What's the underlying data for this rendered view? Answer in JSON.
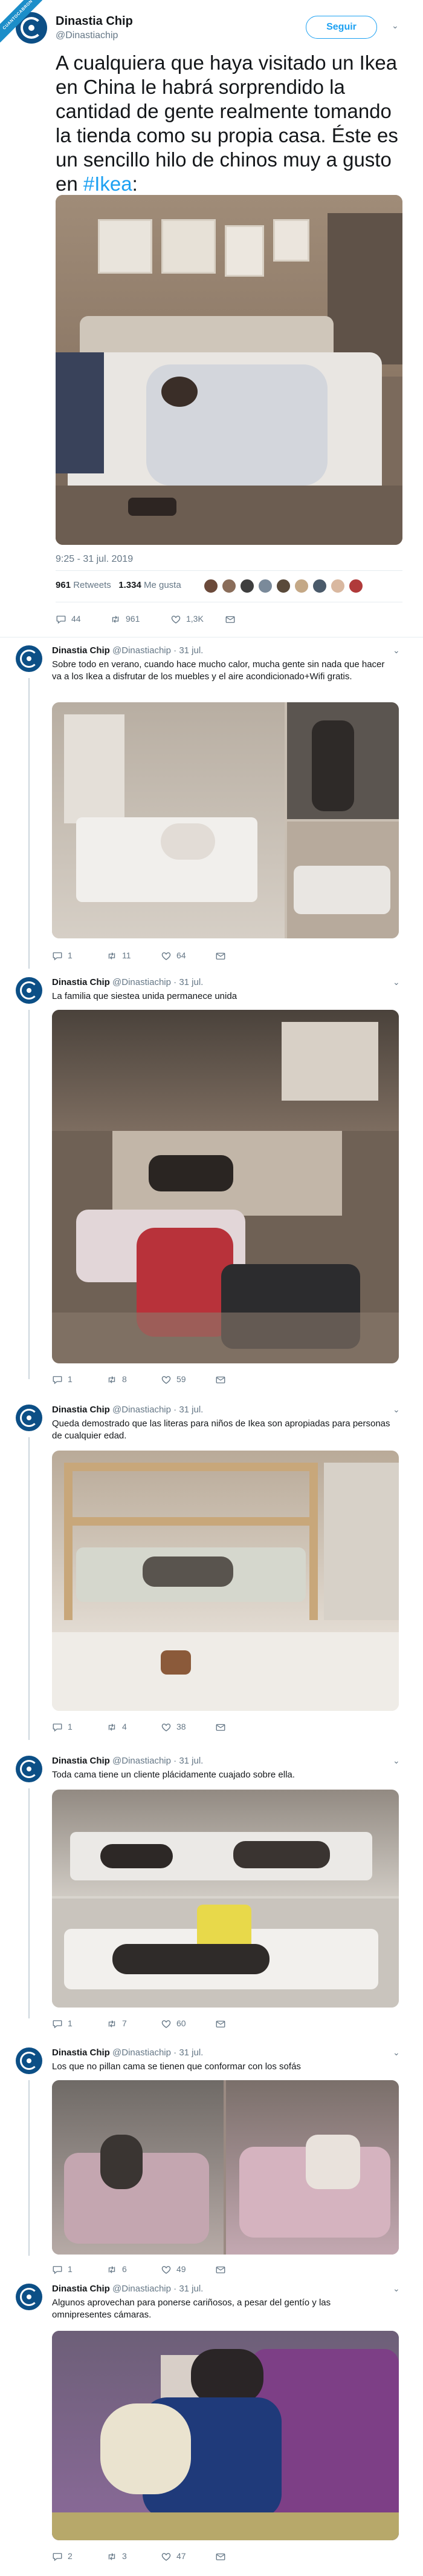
{
  "badge": "CUANTOCABRON",
  "tweet": {
    "author_name": "Dinastia Chip",
    "author_handle": "@Dinastiachip",
    "follow_label": "Seguir",
    "text": "A cualquiera que haya visitado un Ikea en China le habrá sorprendido la cantidad de gente realmente tomando la tienda como su propia casa. Éste es un sencillo hilo de chinos muy a gusto en ",
    "hashtag": "#Ikea",
    "text_end": ":",
    "timestamp": "9:25 - 31 jul. 2019",
    "retweets_count": "961",
    "retweets_label": "Retweets",
    "likes_count": "1.334",
    "likes_label": "Me gusta",
    "reply_count": "44",
    "retweet_count": "961",
    "like_count": "1,3K"
  },
  "replies": [
    {
      "name": "Dinastia Chip",
      "handle": "@Dinastiachip",
      "date": "31 jul.",
      "text": "Sobre todo en verano, cuando hace mucho calor, mucha gente sin nada que hacer va a los Ikea a disfrutar de los muebles y el aire acondicionado+Wifi gratis.",
      "reply": "1",
      "retweet": "11",
      "like": "64"
    },
    {
      "name": "Dinastia Chip",
      "handle": "@Dinastiachip",
      "date": "31 jul.",
      "text": "La familia que siestea unida permanece unida",
      "reply": "1",
      "retweet": "8",
      "like": "59"
    },
    {
      "name": "Dinastia Chip",
      "handle": "@Dinastiachip",
      "date": "31 jul.",
      "text": "Queda demostrado que las literas para niños de Ikea son apropiadas para personas de cualquier edad.",
      "reply": "1",
      "retweet": "4",
      "like": "38"
    },
    {
      "name": "Dinastia Chip",
      "handle": "@Dinastiachip",
      "date": "31 jul.",
      "text": "Toda cama tiene un cliente plácidamente cuajado sobre ella.",
      "reply": "1",
      "retweet": "7",
      "like": "60"
    },
    {
      "name": "Dinastia Chip",
      "handle": "@Dinastiachip",
      "date": "31 jul.",
      "text": "Los que no pillan cama se tienen que conformar con los sofás",
      "reply": "1",
      "retweet": "6",
      "like": "49"
    },
    {
      "name": "Dinastia Chip",
      "handle": "@Dinastiachip",
      "date": "31 jul.",
      "text": "Algunos aprovechan para ponerse cariñosos, a pesar del gentío y las omnipresentes cámaras.",
      "reply": "2",
      "retweet": "3",
      "like": "47"
    }
  ],
  "colors": {
    "accent": "#1da1f2",
    "secondary_text": "#657786",
    "divider": "#e6ecf0",
    "avatar": "#0c4f86"
  },
  "icons": [
    "reply-icon",
    "retweet-icon",
    "like-icon",
    "message-icon",
    "chevron-down-icon",
    "avatar-logo-icon"
  ]
}
